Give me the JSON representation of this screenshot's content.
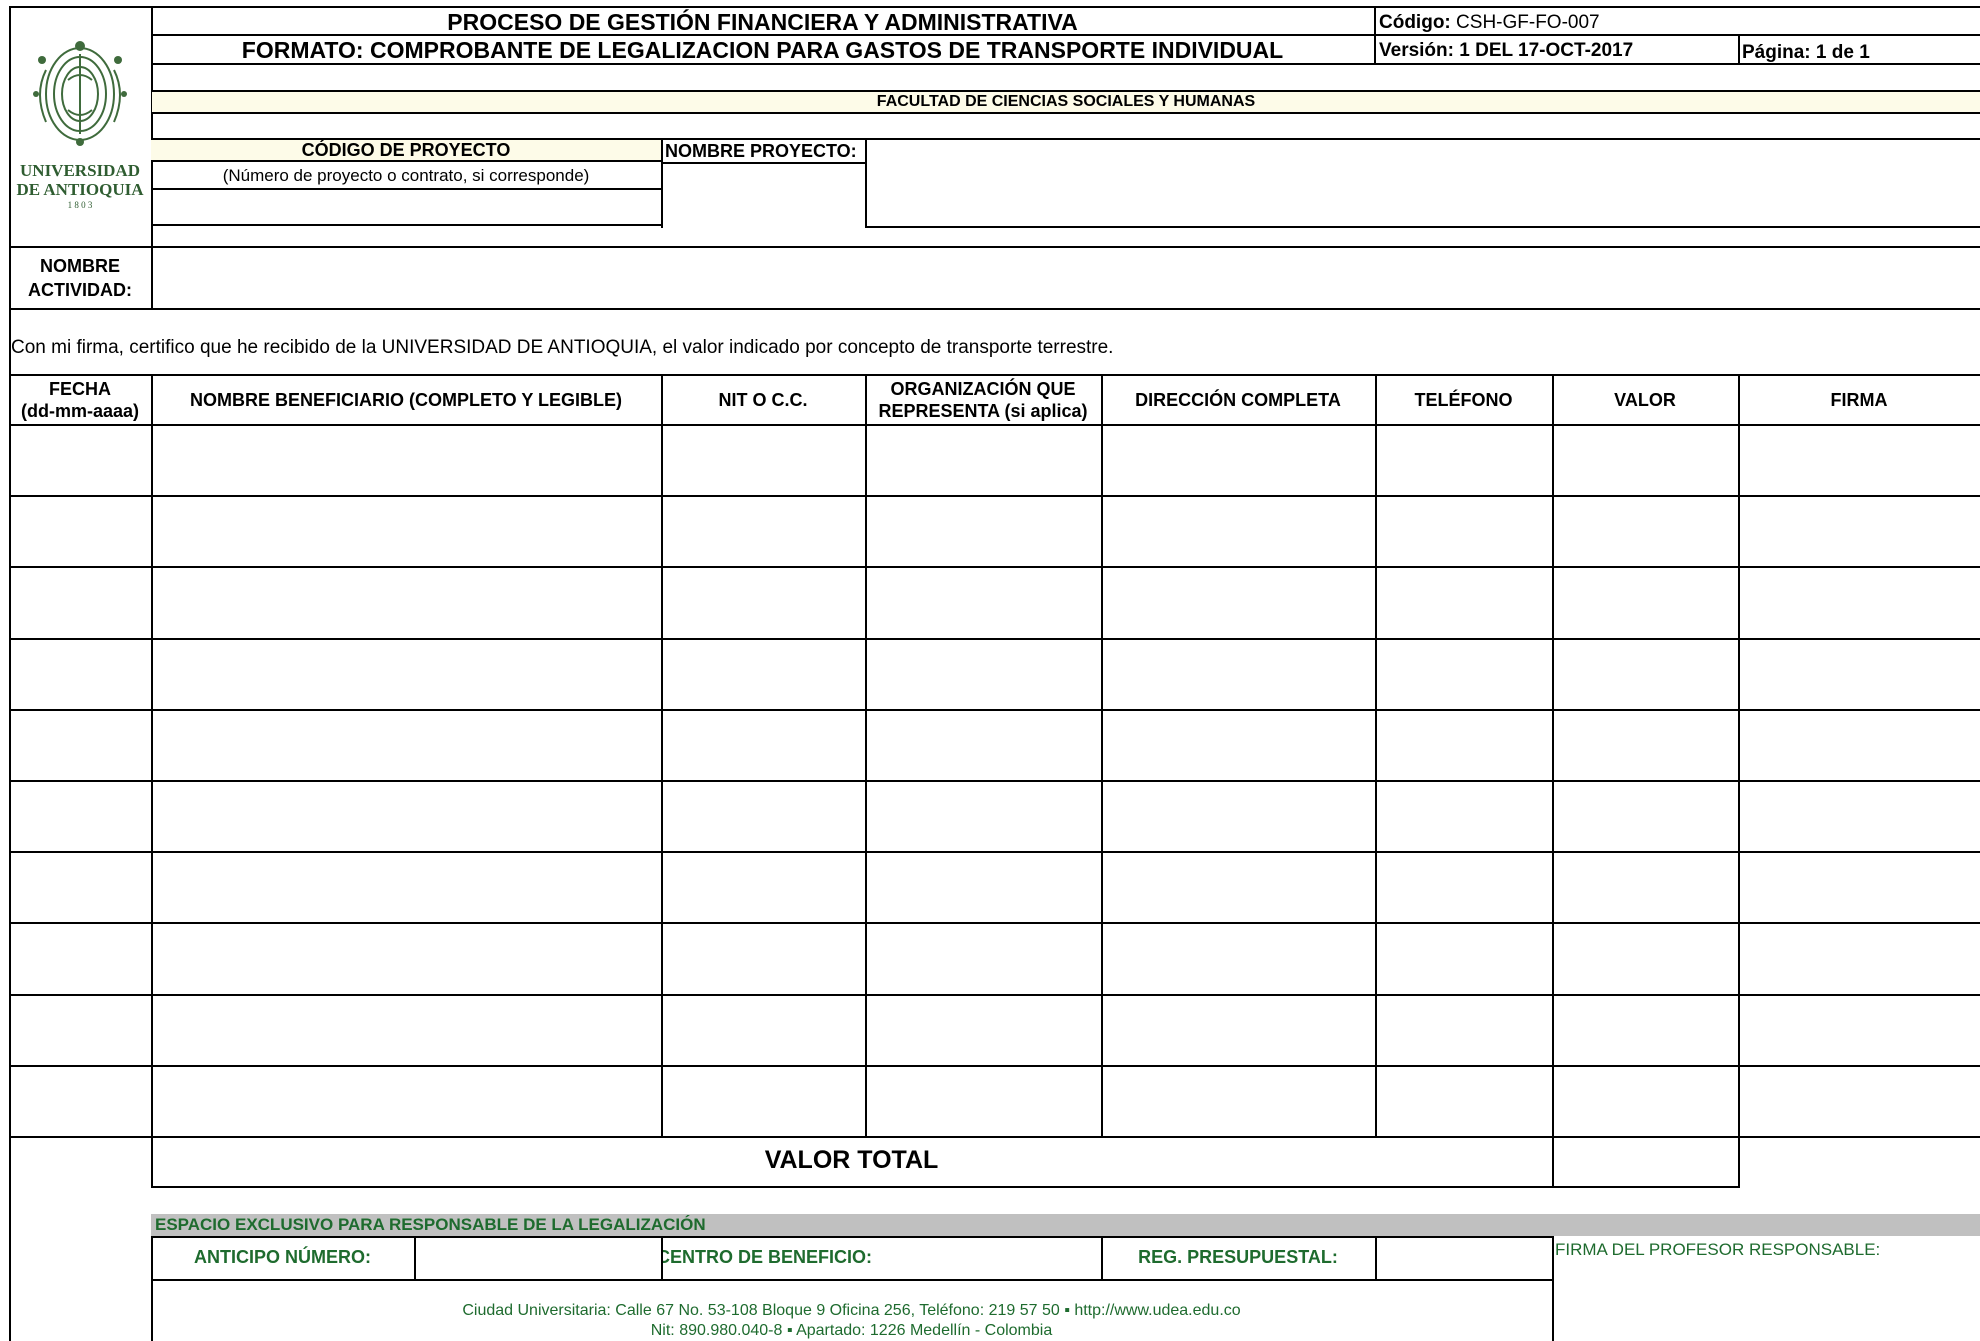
{
  "header": {
    "title_line1": "PROCESO DE GESTIÓN FINANCIERA Y ADMINISTRATIVA",
    "title_line2": "FORMATO: COMPROBANTE DE LEGALIZACION PARA GASTOS DE TRANSPORTE INDIVIDUAL",
    "codigo_label": "Código:",
    "codigo_value": "CSH-GF-FO-007",
    "version_label": "Versión:",
    "version_value": "1 DEL 17-OCT-2017",
    "pagina": "Página: 1 de 1"
  },
  "logo": {
    "line1": "UNIVERSIDAD",
    "line2": "DE ANTIOQUIA",
    "year": "1 8 0 3",
    "icon": "university-seal-icon"
  },
  "faculty": "FACULTAD DE CIENCIAS SOCIALES Y HUMANAS",
  "project": {
    "code_label": "CÓDIGO DE PROYECTO",
    "code_hint": "(Número de proyecto o contrato, si corresponde)",
    "code_value": "",
    "name_label": "NOMBRE PROYECTO:",
    "name_value": ""
  },
  "activity": {
    "label_line1": "NOMBRE",
    "label_line2": "ACTIVIDAD:",
    "value": ""
  },
  "certification": "Con mi firma, certifico que he recibido de la UNIVERSIDAD DE ANTIOQUIA, el valor indicado por concepto de transporte terrestre.",
  "table": {
    "columns": [
      {
        "line1": "FECHA",
        "line2": "(dd-mm-aaaa)"
      },
      {
        "line1": "NOMBRE BENEFICIARIO (COMPLETO Y LEGIBLE)",
        "line2": ""
      },
      {
        "line1": "NIT O C.C.",
        "line2": ""
      },
      {
        "line1": "ORGANIZACIÓN QUE",
        "line2": "REPRESENTA (si aplica)"
      },
      {
        "line1": "DIRECCIÓN COMPLETA",
        "line2": ""
      },
      {
        "line1": "TELÉFONO",
        "line2": ""
      },
      {
        "line1": "VALOR",
        "line2": ""
      },
      {
        "line1": "FIRMA",
        "line2": ""
      }
    ],
    "rows": [
      [
        "",
        "",
        "",
        "",
        "",
        "",
        "",
        ""
      ],
      [
        "",
        "",
        "",
        "",
        "",
        "",
        "",
        ""
      ],
      [
        "",
        "",
        "",
        "",
        "",
        "",
        "",
        ""
      ],
      [
        "",
        "",
        "",
        "",
        "",
        "",
        "",
        ""
      ],
      [
        "",
        "",
        "",
        "",
        "",
        "",
        "",
        ""
      ],
      [
        "",
        "",
        "",
        "",
        "",
        "",
        "",
        ""
      ],
      [
        "",
        "",
        "",
        "",
        "",
        "",
        "",
        ""
      ],
      [
        "",
        "",
        "",
        "",
        "",
        "",
        "",
        ""
      ],
      [
        "",
        "",
        "",
        "",
        "",
        "",
        "",
        ""
      ],
      [
        "",
        "",
        "",
        "",
        "",
        "",
        "",
        ""
      ]
    ],
    "total_label": "VALOR TOTAL",
    "total_value": ""
  },
  "responsible": {
    "section_title": "ESPACIO EXCLUSIVO PARA RESPONSABLE DE LA LEGALIZACIÓN",
    "anticipo_label": "ANTICIPO NÚMERO:",
    "anticipo_value": "",
    "centro_label": "CENTRO DE BENEFICIO:",
    "reg_label": "REG. PRESUPUESTAL:",
    "reg_value": "",
    "firma_label": "FIRMA DEL PROFESOR RESPONSABLE:"
  },
  "footer": {
    "line1": "Ciudad Universitaria: Calle 67 No. 53-108 Bloque 9 Oficina 256, Teléfono: 219 57 50 ▪ http://www.udea.edu.co",
    "line2": "Nit: 890.980.040-8 ▪ Apartado: 1226 Medellín - Colombia"
  },
  "colors": {
    "cream": "#fdfbe8",
    "green": "#1e6b2e",
    "gray_band": "#c0c0c0"
  }
}
